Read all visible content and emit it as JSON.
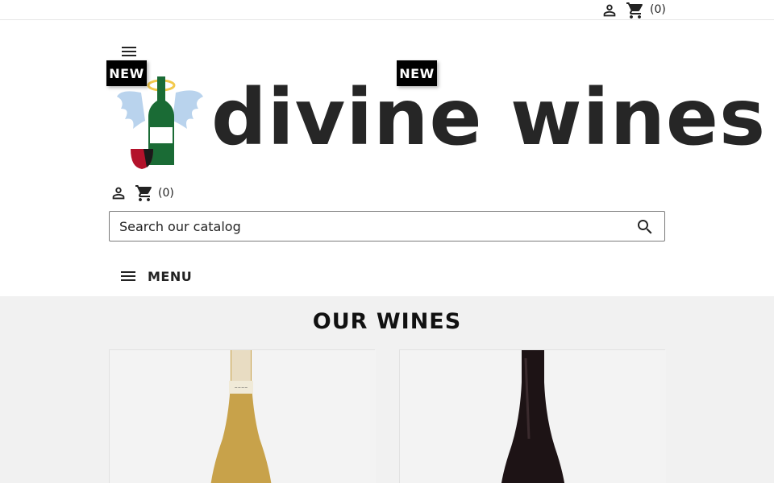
{
  "header": {
    "cart_count_label": "(0)",
    "user_icon": "person-icon",
    "cart_icon": "shopping-cart-icon"
  },
  "logo": {
    "text": "divine wines",
    "colors": {
      "text": "#262626",
      "bottle": "#1a6b35",
      "halo": "#f2c94c",
      "wings": "#a8c8e8",
      "glass": "#b3122b"
    }
  },
  "header_secondary": {
    "cart_count_label": "(0)"
  },
  "search": {
    "placeholder": "Search our catalog"
  },
  "menu": {
    "label": "MENU"
  },
  "section": {
    "title": "OUR WINES",
    "background": "#f1f1f1"
  },
  "products": [
    {
      "badge": "NEW",
      "bottle_color": "#c8a24a"
    },
    {
      "badge": "NEW",
      "bottle_color": "#1d1315"
    }
  ]
}
